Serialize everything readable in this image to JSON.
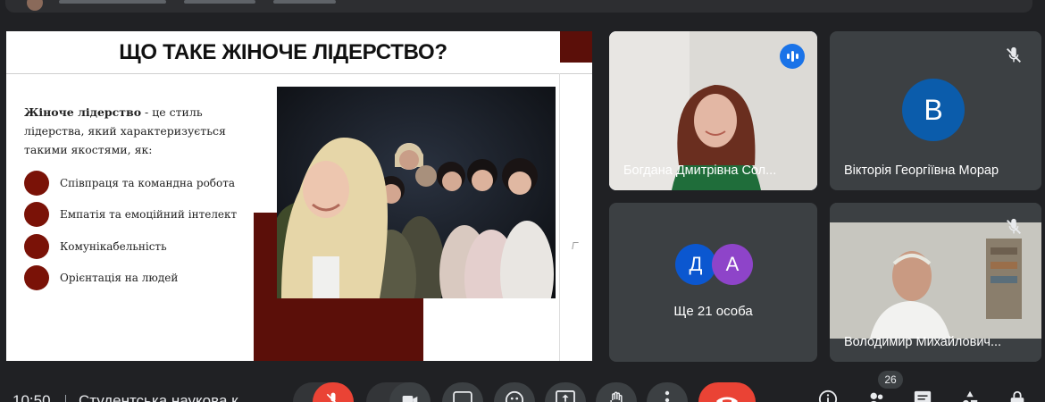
{
  "slide": {
    "title": "ЩО ТАКЕ ЖІНОЧЕ ЛІДЕРСТВО?",
    "intro_bold": "Жіноче лідерство",
    "intro_rest": " - це стиль лідерства, який характеризується такими якостями, як:",
    "bullets": [
      "Співпраця та командна робота",
      "Емпатія та емоційний інтелект",
      "Комунікабельність",
      "Орієнтація на людей"
    ],
    "accent_color": "#5b0f09"
  },
  "participants": {
    "speaker_tile": {
      "name": "Богдана Дмитрівна Сол...",
      "state": "speaking"
    },
    "avatar_tile": {
      "name": "Вікторія Георгіївна Морар",
      "initial": "В",
      "avatar_color": "#0b5cab",
      "state": "muted"
    },
    "others_tile": {
      "label": "Ще 21 особа",
      "initials": [
        "Д",
        "А"
      ],
      "colors": [
        "#0b57d0",
        "#8e44c9"
      ]
    },
    "video_tile": {
      "name": "Володимир Михайлович...",
      "state": "muted"
    }
  },
  "bottom_bar": {
    "time": "10:50",
    "meeting_title": "Студентська наукова к",
    "participant_count": "26",
    "controls": [
      "mic-toggle",
      "camera-toggle",
      "captions",
      "emoji",
      "present",
      "raise-hand",
      "more-options",
      "leave-call"
    ],
    "right_controls": [
      "meeting-info",
      "people",
      "chat",
      "activities",
      "host-controls"
    ]
  }
}
